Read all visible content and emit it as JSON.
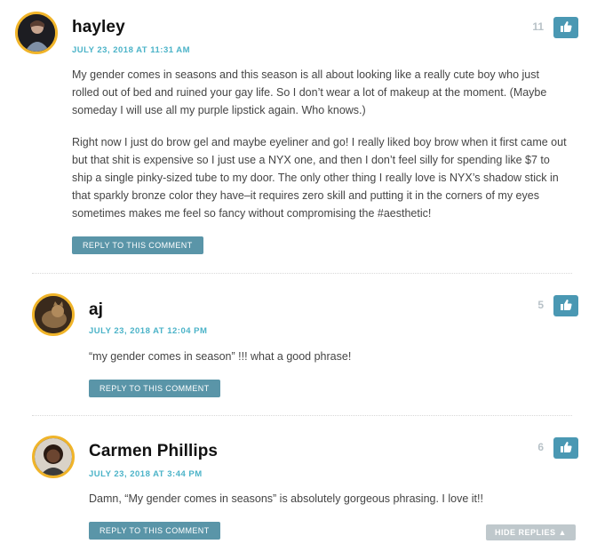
{
  "comments": [
    {
      "author": "hayley",
      "date": "JULY 23, 2018 AT 11:31 AM",
      "likes": "11",
      "paragraphs": [
        "My gender comes in seasons and this season is all about looking like a really cute boy who just rolled out of bed and ruined your gay life. So I don’t wear a lot of makeup at the moment. (Maybe someday I will use all my purple lipstick again. Who knows.)",
        "Right now I just do brow gel and maybe eyeliner and go! I really liked boy brow when it first came out but that shit is expensive so I just use a NYX one, and then I don’t feel silly for spending like $7 to ship a single pinky-sized tube to my door. The only other thing I really love is NYX’s shadow stick in that sparkly bronze color they have–it requires zero skill and putting it in the corners of my eyes sometimes makes me feel so fancy without compromising the #aesthetic!"
      ],
      "reply_label": "REPLY TO THIS COMMENT"
    },
    {
      "author": "aj",
      "date": "JULY 23, 2018 AT 12:04 PM",
      "likes": "5",
      "paragraphs": [
        "“my gender comes in season” !!! what a good phrase!"
      ],
      "reply_label": "REPLY TO THIS COMMENT"
    },
    {
      "author": "Carmen Phillips",
      "date": "JULY 23, 2018 AT 3:44 PM",
      "likes": "6",
      "paragraphs": [
        "Damn, “My gender comes in seasons” is absolutely gorgeous phrasing. I love it!!"
      ],
      "reply_label": "REPLY TO THIS COMMENT"
    }
  ],
  "hide_replies_label": "HIDE REPLIES ▲",
  "colors": {
    "accent": "#4bb3c8",
    "like_button": "#4a98b3",
    "reply_button": "#5a95a8",
    "avatar_border": "#f0b429",
    "hide_button": "#bfc8cc"
  },
  "icons": {
    "like": "thumbs-up-icon"
  }
}
